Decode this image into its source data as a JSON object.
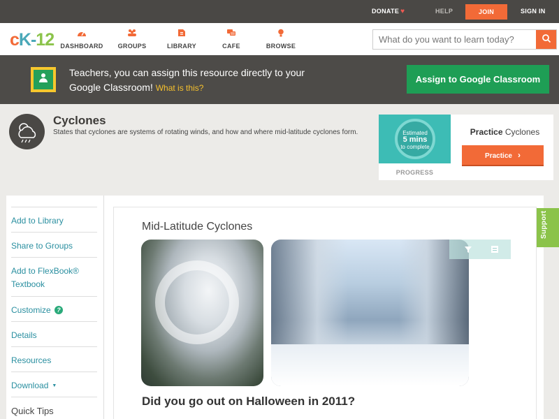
{
  "topbar": {
    "donate": "DONATE",
    "help": "HELP",
    "join": "JOIN",
    "signin": "SIGN IN"
  },
  "nav": {
    "logo": {
      "c": "c",
      "k": "K-",
      "num": "12"
    },
    "items": [
      {
        "label": "DASHBOARD",
        "icon": "dashboard-icon"
      },
      {
        "label": "GROUPS",
        "icon": "groups-icon"
      },
      {
        "label": "LIBRARY",
        "icon": "library-icon"
      },
      {
        "label": "CAFE",
        "icon": "cafe-icon"
      },
      {
        "label": "BROWSE",
        "icon": "browse-icon"
      }
    ],
    "search_placeholder": "What do you want to learn today?"
  },
  "banner": {
    "text": "Teachers, you can assign this resource directly to your Google Classroom!",
    "link": "What is this?",
    "button": "Assign to Google Classroom"
  },
  "concept": {
    "title": "Cyclones",
    "description": "States that cyclones are systems of rotating winds, and how and where mid-latitude cyclones form."
  },
  "practice": {
    "estimated_line1": "Estimated",
    "estimated_mins": "5 mins",
    "estimated_line3": "to complete",
    "progress_label": "PROGRESS",
    "heading_bold": "Practice",
    "heading_rest": "Cyclones",
    "button": "Practice"
  },
  "sidebar": {
    "items": [
      {
        "label": "Add to Library"
      },
      {
        "label": "Share to Groups"
      },
      {
        "label": "Add to FlexBook® Textbook"
      },
      {
        "label": "Customize"
      },
      {
        "label": "Details"
      },
      {
        "label": "Resources"
      },
      {
        "label": "Download"
      },
      {
        "label": "Quick Tips"
      }
    ]
  },
  "article": {
    "title": "Mid-Latitude Cyclones",
    "subtitle": "Did you go out on Halloween in 2011?"
  },
  "support_tab": "Support",
  "colors": {
    "orange": "#f26a37",
    "green": "#1e9e55",
    "teal_link": "#2a8fa0",
    "support_green": "#8bc34a"
  }
}
